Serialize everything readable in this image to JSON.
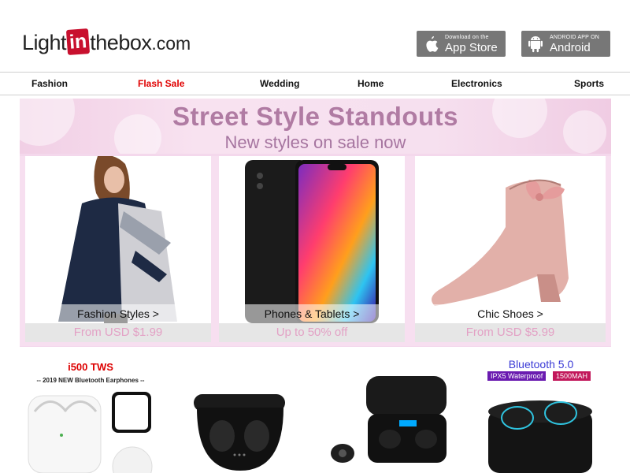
{
  "brand": {
    "part1": "Light",
    "part2": "in",
    "part3": "thebox",
    "part4": ".com"
  },
  "apps": {
    "appstore": {
      "small": "Download on the",
      "big": "App Store",
      "icon": "apple-icon"
    },
    "android": {
      "small": "ANDROID APP ON",
      "big": "Android",
      "icon": "android-icon"
    }
  },
  "nav": [
    "Fashion",
    "Flash Sale",
    "Wedding",
    "Home",
    "Electronics",
    "Sports"
  ],
  "banner": {
    "title": "Street Style Standouts",
    "subtitle": "New styles on sale now",
    "cards": [
      {
        "label": "Fashion Styles >",
        "price": "From USD $1.99"
      },
      {
        "label": "Phones & Tablets >",
        "price": "Up to 50% off"
      },
      {
        "label": "Chic Shoes >",
        "price": "From USD $5.99"
      }
    ]
  },
  "products": {
    "p1": {
      "title": "i500 TWS",
      "subtitle": "-- 2019 NEW Bluetooth Earphones --"
    },
    "p4": {
      "title": "Bluetooth 5.0",
      "tag1": "IPX5 Waterproof",
      "tag2": "1500MAH"
    }
  },
  "colors": {
    "nav_flash": "#e00000",
    "banner_bg": "#f4d8ec",
    "title": "#b07ba3",
    "price": "#e3a1c5"
  }
}
